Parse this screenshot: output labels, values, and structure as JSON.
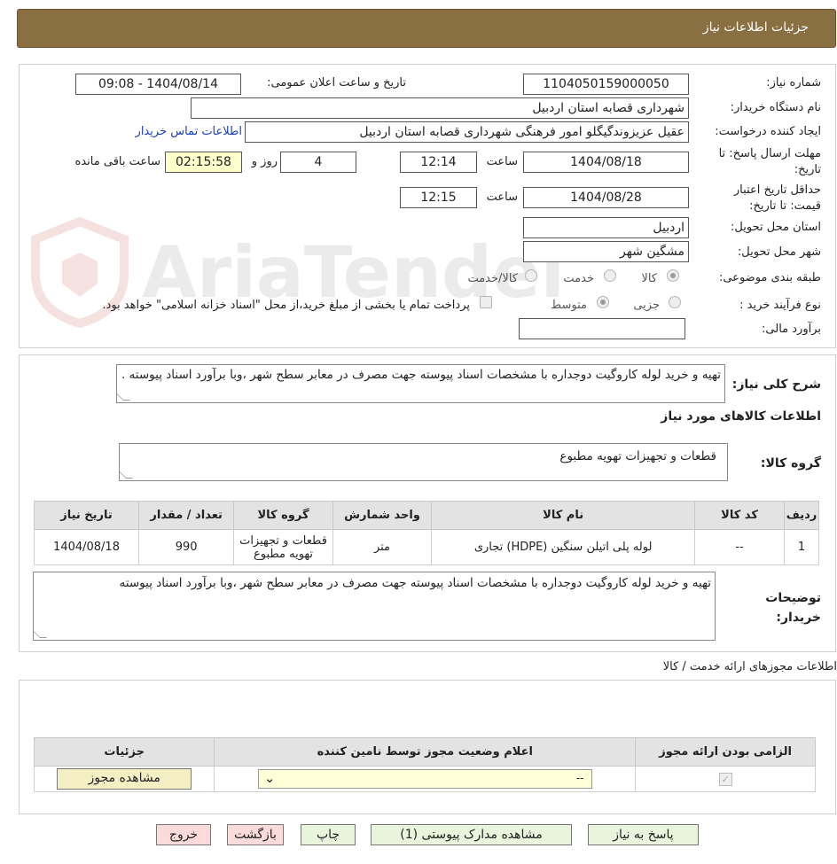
{
  "header": {
    "title": "جزئيات اطلاعات نياز"
  },
  "watermark": {
    "text": "AriaTender.neT"
  },
  "form": {
    "need_number": {
      "label": "شماره نیاز:",
      "value": "1104050159000050"
    },
    "announce": {
      "label": "تاریخ و ساعت اعلان عمومی:",
      "value": "1404/08/14 - 09:08"
    },
    "buyer_org": {
      "label": "نام دستگاه خریدار:",
      "value": "شهرداری قصابه استان اردبیل"
    },
    "requester": {
      "label": "ایجاد کننده درخواست:",
      "value": "عقیل عزیزوندگیگلو امور فرهنگی شهرداری قصابه استان اردبیل",
      "contact_link": "اطلاعات تماس خریدار"
    },
    "deadline": {
      "label": "مهلت ارسال پاسخ: تا تاریخ:",
      "date": "1404/08/18",
      "time_label": "ساعت",
      "time": "12:14",
      "days": "4",
      "days_label": "روز و",
      "remaining": "02:15:58",
      "remaining_label": "ساعت باقی مانده"
    },
    "validity": {
      "label": "حداقل تاریخ اعتبار قیمت: تا تاریخ:",
      "date": "1404/08/28",
      "time_label": "ساعت",
      "time": "12:15"
    },
    "province": {
      "label": "استان محل تحویل:",
      "value": "اردبیل"
    },
    "city": {
      "label": "شهر محل تحویل:",
      "value": "مشگین شهر"
    },
    "category": {
      "label": "طبقه بندی موضوعی:",
      "options": [
        "کالا",
        "خدمت",
        "کالا/خدمت"
      ]
    },
    "process": {
      "label": "نوع فرآیند خرید :",
      "options": [
        "جزیی",
        "متوسط"
      ],
      "note": "پرداخت تمام یا بخشی از مبلغ خرید،از محل \"اسناد خزانه اسلامی\" خواهد بود."
    },
    "estimate": {
      "label": "برآورد مالی:",
      "value": ""
    }
  },
  "summary": {
    "label": "شرح کلی نیاز:",
    "text": "تهیه و خرید لوله کاروگیت دوجداره با مشخصات اسناد پیوسته جهت مصرف در معابر سطح شهر ،وبا برآورد اسناد پیوسته ."
  },
  "goods": {
    "title": "اطلاعات کالاهای مورد نیاز",
    "group_label": "گروه کالا:",
    "group_value": "قطعات و تجهیزات تهویه مطبوع",
    "columns": [
      "ردیف",
      "کد کالا",
      "نام کالا",
      "واحد شمارش",
      "گروه کالا",
      "تعداد / مقدار",
      "تاریخ نیاز"
    ],
    "rows": [
      {
        "row": "1",
        "code": "--",
        "name": "لوله پلی اتیلن سنگین (HDPE) تجاری",
        "unit": "متر",
        "group": "قطعات و تجهیزات تهویه مطبوع",
        "qty": "990",
        "date": "1404/08/18"
      }
    ]
  },
  "buyer_notes": {
    "label": "توضیحات خریدار:",
    "text": "تهیه و خرید لوله کاروگیت دوجداره با مشخصات اسناد پیوسته جهت مصرف در معابر سطح شهر ،وبا برآورد اسناد پیوسته"
  },
  "permits": {
    "title": "اطلاعات مجوزهای ارائه خدمت / کالا",
    "columns": [
      "الزامی بودن ارائه مجوز",
      "اعلام وضعیت مجوز توسط نامین کننده",
      "جزئیات"
    ],
    "select_value": "--",
    "view_button": "مشاهده مجوز"
  },
  "buttons": {
    "reply": "پاسخ به نیاز",
    "attachments": "مشاهده مدارک پیوستی (1)",
    "print": "چاپ",
    "back": "بازگشت",
    "exit": "خروج"
  }
}
